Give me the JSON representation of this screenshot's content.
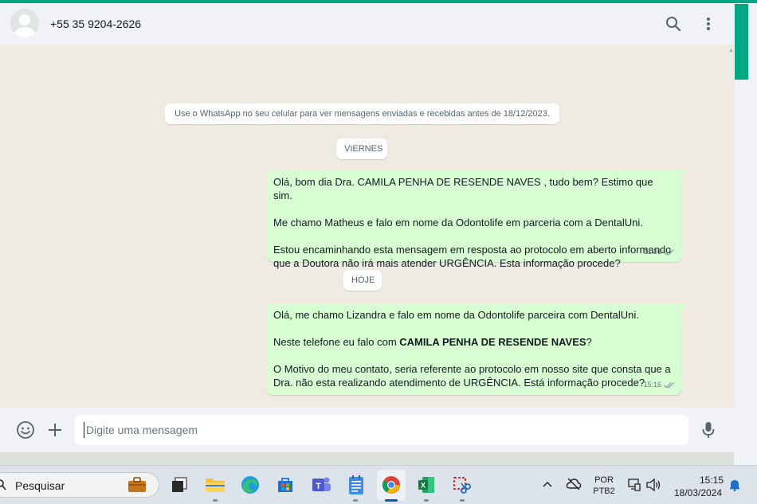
{
  "header": {
    "contact_name": "+55 35 9204-2626",
    "icons": [
      "avatar-icon",
      "search-icon",
      "more-vert-icon"
    ]
  },
  "chat": {
    "system_notice": "Use o WhatsApp no seu celular para ver mensagens enviadas e recebidas antes de 18/12/2023.",
    "day_label_1": "VIERNES",
    "day_label_2": "HOJE",
    "message_1": {
      "line_1": "Olá, bom dia Dra. CAMILA PENHA DE RESENDE NAVES , tudo bem? Estimo que sim.",
      "line_2": "Me chamo Matheus e falo em nome da Odontolife em parceria com a DentalUni.",
      "line_3a": "Estou encaminhando esta mensagem em resposta ao protocolo em aberto informando",
      "line_3b": "que a Doutora não irá mais atender URGÊNCIA. Esta informação procede?",
      "time": "11:31",
      "status": "read"
    },
    "message_2": {
      "line_1": "Olá, me chamo Lizandra e falo em nome da Odontolife parceira com DentalUni.",
      "line_2_prefix": "Neste telefone eu falo com ",
      "line_2_bold": "CAMILA PENHA DE RESENDE NAVES",
      "line_2_suffix": "?",
      "line_3a": "O Motivo do meu contato, seria referente ao protocolo em nosso site que consta que a",
      "line_3b": "Dra. não esta realizando atendimento de URGÊNCIA. Está informação procede?",
      "time": "15:16",
      "status": "read"
    }
  },
  "composer": {
    "placeholder": "Digite uma mensagem",
    "value": ""
  },
  "taskbar": {
    "search_label": "Pesquisar",
    "apps": [
      "work-icon",
      "task-view-icon",
      "file-explorer-icon",
      "edge-icon",
      "store-icon",
      "teams-icon",
      "notepad-icon",
      "chrome-icon",
      "excel-icon",
      "snipping-tool-icon"
    ],
    "active_app": "chrome-icon",
    "language": "POR",
    "keyboard": "PTB2",
    "clock_time": "15:15",
    "clock_date": "18/03/2024"
  },
  "colors": {
    "accent": "#00a884",
    "outgoing_bubble": "#d9fdd3",
    "chat_bg": "#efeae2",
    "panel_bg": "#f0f2f5",
    "taskbar_bg": "#dce3ea",
    "read_ticks": "#53bdeb"
  }
}
